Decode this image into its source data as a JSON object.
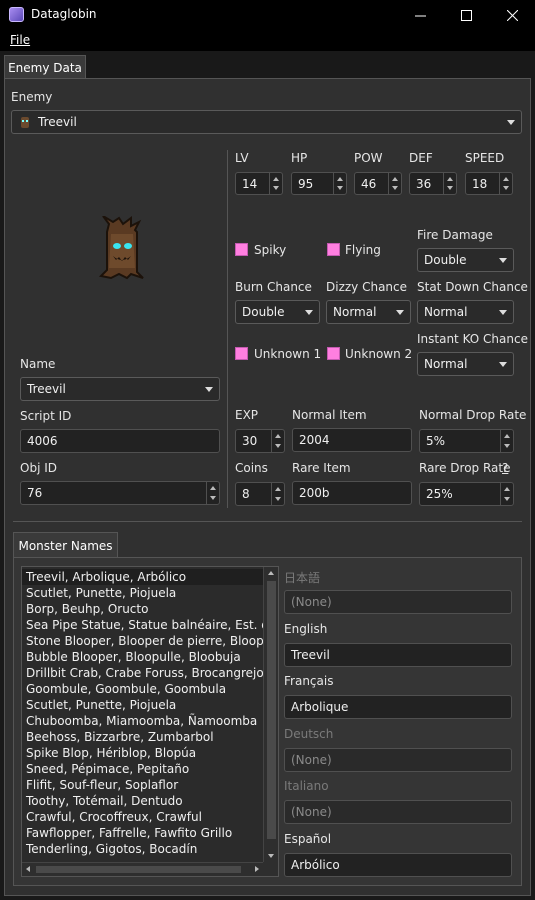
{
  "window": {
    "title": "Dataglobin"
  },
  "menu": {
    "file": "File"
  },
  "tabs": {
    "enemy_data": "Enemy Data",
    "monster_names": "Monster Names"
  },
  "enemy": {
    "label": "Enemy",
    "selected": "Treevil"
  },
  "stats": {
    "lv": {
      "label": "LV",
      "value": "14"
    },
    "hp": {
      "label": "HP",
      "value": "95"
    },
    "pow": {
      "label": "POW",
      "value": "46"
    },
    "def": {
      "label": "DEF",
      "value": "36"
    },
    "speed": {
      "label": "SPEED",
      "value": "18"
    }
  },
  "flags": {
    "spiky": "Spiky",
    "flying": "Flying",
    "unknown1": "Unknown 1",
    "unknown2": "Unknown 2"
  },
  "fire_damage": {
    "label": "Fire Damage",
    "value": "Double"
  },
  "burn_chance": {
    "label": "Burn Chance",
    "value": "Double"
  },
  "dizzy_chance": {
    "label": "Dizzy Chance",
    "value": "Normal"
  },
  "stat_down_chance": {
    "label": "Stat Down Chance",
    "value": "Normal"
  },
  "instant_ko_chance": {
    "label": "Instant KO Chance",
    "value": "Normal"
  },
  "name": {
    "label": "Name",
    "value": "Treevil"
  },
  "script_id": {
    "label": "Script ID",
    "value": "4006"
  },
  "obj_id": {
    "label": "Obj ID",
    "value": "76"
  },
  "exp": {
    "label": "EXP",
    "value": "30"
  },
  "normal_item": {
    "label": "Normal Item",
    "value": "2004"
  },
  "normal_drop_rate": {
    "label": "Normal Drop Rate",
    "value": "5%"
  },
  "coins": {
    "label": "Coins",
    "value": "8"
  },
  "rare_item": {
    "label": "Rare Item",
    "value": "200b"
  },
  "rare_drop_rate": {
    "label": "Rare Drop Rate",
    "help": "?",
    "value": "25%"
  },
  "monster_names": [
    "Treevil, Arbolique, Arbólico",
    "Scutlet, Punette, Piojuela",
    "Borp, Beuhp, Oructo",
    "Sea Pipe Statue, Statue balnéaire, Est. del balneario",
    "Stone Blooper, Blooper de pierre, Blooper de piedra",
    "Bubble Blooper, Bloopulle, Bloobuja",
    "Drillbit Crab, Crabe Foruss, Brocangrejo",
    "Goombule, Goombule, Goombula",
    "Scutlet, Punette, Piojuela",
    "Chuboomba, Miamoomba, Ñamoomba",
    "Beehoss, Bizzarbre, Zumbarbol",
    "Spike Blop, Hériblop, Blopúa",
    "Sneed, Pépimace, Pepitaño",
    "Flifit, Souf-fleur, Soplaflor",
    "Toothy, Totémail, Dentudo",
    "Crawful, Crocoffreux, Crawful",
    "Fawflopper, Faffrelle, Fawfito Grillo",
    "Tenderling, Gigotos, Bocadín"
  ],
  "languages": [
    {
      "name": "日本語",
      "value": "(None)",
      "enabled": false
    },
    {
      "name": "English",
      "value": "Treevil",
      "enabled": true
    },
    {
      "name": "Français",
      "value": "Arbolique",
      "enabled": true
    },
    {
      "name": "Deutsch",
      "value": "(None)",
      "enabled": false
    },
    {
      "name": "Italiano",
      "value": "(None)",
      "enabled": false
    },
    {
      "name": "Español",
      "value": "Arbólico",
      "enabled": true
    }
  ],
  "colors": {
    "checkbox": "#ff7fe0",
    "panel": "#303030",
    "field": "#222222"
  },
  "icons": {
    "window_minimize": "minimize-icon",
    "window_maximize": "maximize-icon",
    "window_close": "close-icon"
  }
}
